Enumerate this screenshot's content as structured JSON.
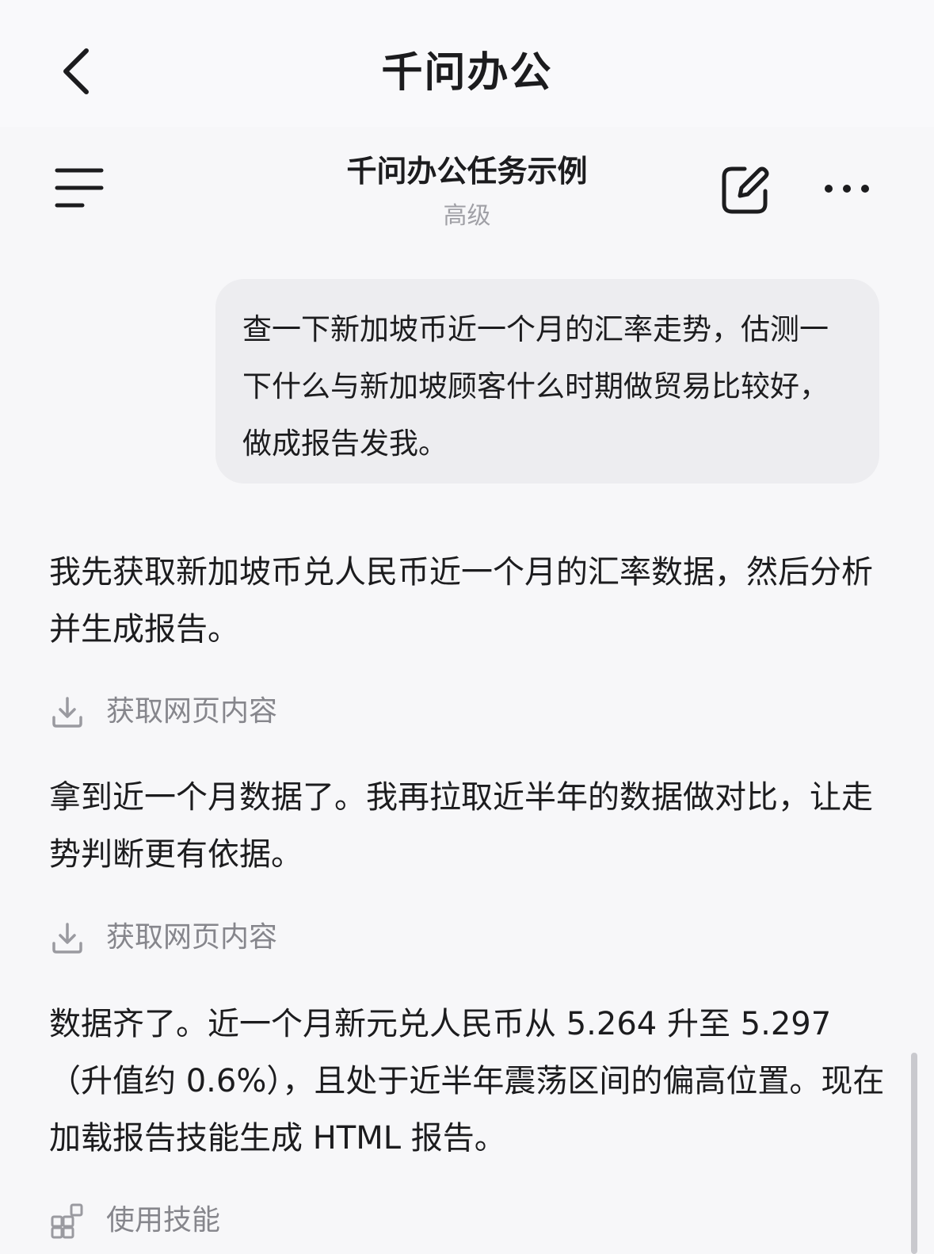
{
  "header": {
    "app_title": "千问办公"
  },
  "conversation": {
    "title": "千问办公任务示例",
    "mode": "高级"
  },
  "user_message": {
    "text": "查一下新加坡币近一个月的汇率走势，估测一下什么与新加坡顾客什么时期做贸易比较好，做成报告发我。"
  },
  "assistant": {
    "message_1": "我先获取新加坡币兑人民币近一个月的汇率数据，然后分析并生成报告。",
    "step_1": "获取网页内容",
    "message_2": "拿到近一个月数据了。我再拉取近半年的数据做对比，让走势判断更有依据。",
    "step_2": "获取网页内容",
    "message_3": "数据齐了。近一个月新元兑人民币从 5.264 升至 5.297（升值约 0.6%），且处于近半年震荡区间的偏高位置。现在加载报告技能生成 HTML 报告。",
    "step_3": "使用技能"
  },
  "icons": {
    "back": "chevron-left-icon",
    "menu": "menu-icon",
    "edit": "edit-icon",
    "more": "more-icon",
    "download": "download-icon",
    "skill": "skill-grid-icon"
  },
  "colors": {
    "background": "#f7f7f9",
    "bubble": "#ededf0",
    "text": "#1c1c1e",
    "muted": "#86868c",
    "subtitle": "#a0a0a6"
  }
}
